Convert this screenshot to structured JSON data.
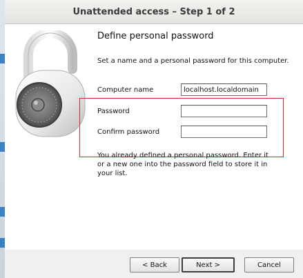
{
  "window": {
    "title": "Unattended access – Step 1 of 2"
  },
  "content": {
    "heading": "Define personal password",
    "description": "Set a name and a personal password for this computer.",
    "computer_name_label": "Computer name",
    "computer_name_value": "localhost.localdomain",
    "password_label": "Password",
    "password_value": "",
    "confirm_label": "Confirm password",
    "confirm_value": "",
    "note": "You already defined a personal password. Enter it or a new one into the password field to store it in your list."
  },
  "buttons": {
    "back": "< Back",
    "next": "Next >",
    "cancel": "Cancel"
  },
  "icons": {
    "illustration": "padlock-icon"
  },
  "colors": {
    "highlight": "#d22a2a"
  }
}
